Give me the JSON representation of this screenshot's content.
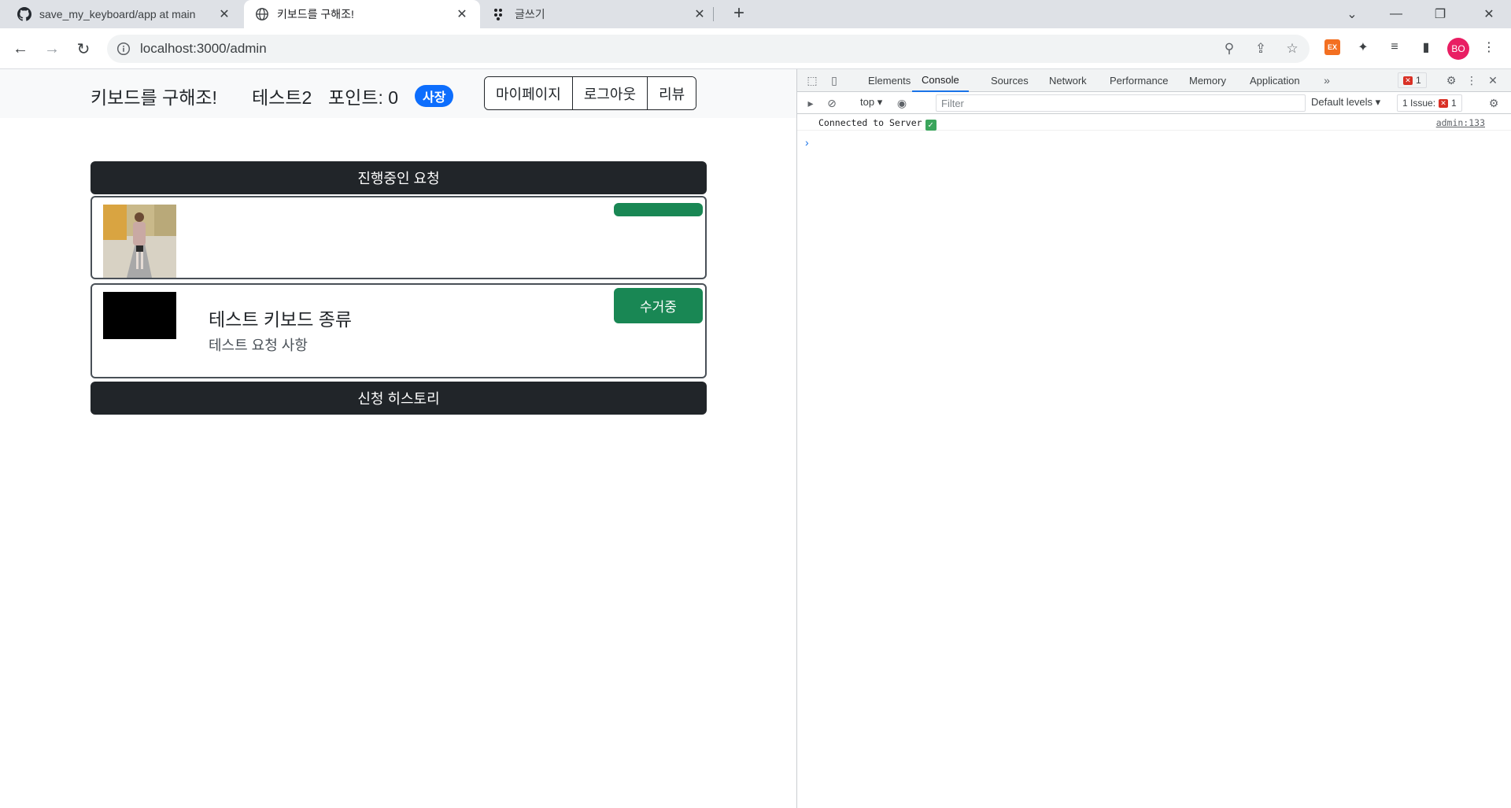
{
  "browser": {
    "tabs": [
      {
        "title": "save_my_keyboard/app at main",
        "icon": "github-icon"
      },
      {
        "title": "키보드를 구해조!",
        "icon": "globe-icon"
      },
      {
        "title": "글쓰기",
        "icon": "dots-icon"
      }
    ],
    "url": "localhost:3000/admin",
    "profile_initials": "BO",
    "ext_badge": "EX"
  },
  "navbar": {
    "brand": "키보드를 구해조!",
    "user_name": "테스트2",
    "points_label": "포인트: 0",
    "role_badge": "사장",
    "buttons": [
      "마이페이지",
      "로그아웃",
      "리뷰"
    ]
  },
  "sections": {
    "in_progress": "진행중인 요청",
    "history": "신청 히스토리"
  },
  "requests": [
    {
      "title": "",
      "description": "",
      "status": "",
      "thumb": "photo"
    },
    {
      "title": "테스트 키보드 종류",
      "description": "테스트 요청 사항",
      "status": "수거중",
      "thumb": "black"
    }
  ],
  "devtools": {
    "tabs": [
      "Elements",
      "Console",
      "Sources",
      "Network",
      "Performance",
      "Memory",
      "Application"
    ],
    "active_tab": "Console",
    "error_count": "1",
    "context": "top",
    "filter_placeholder": "Filter",
    "levels": "Default levels",
    "issues_label": "1 Issue:",
    "issues_count": "1",
    "console_message": "Connected to Server",
    "console_source": "admin:133"
  },
  "colors": {
    "primary": "#0d6efd",
    "success": "#198754",
    "dark": "#212529"
  }
}
